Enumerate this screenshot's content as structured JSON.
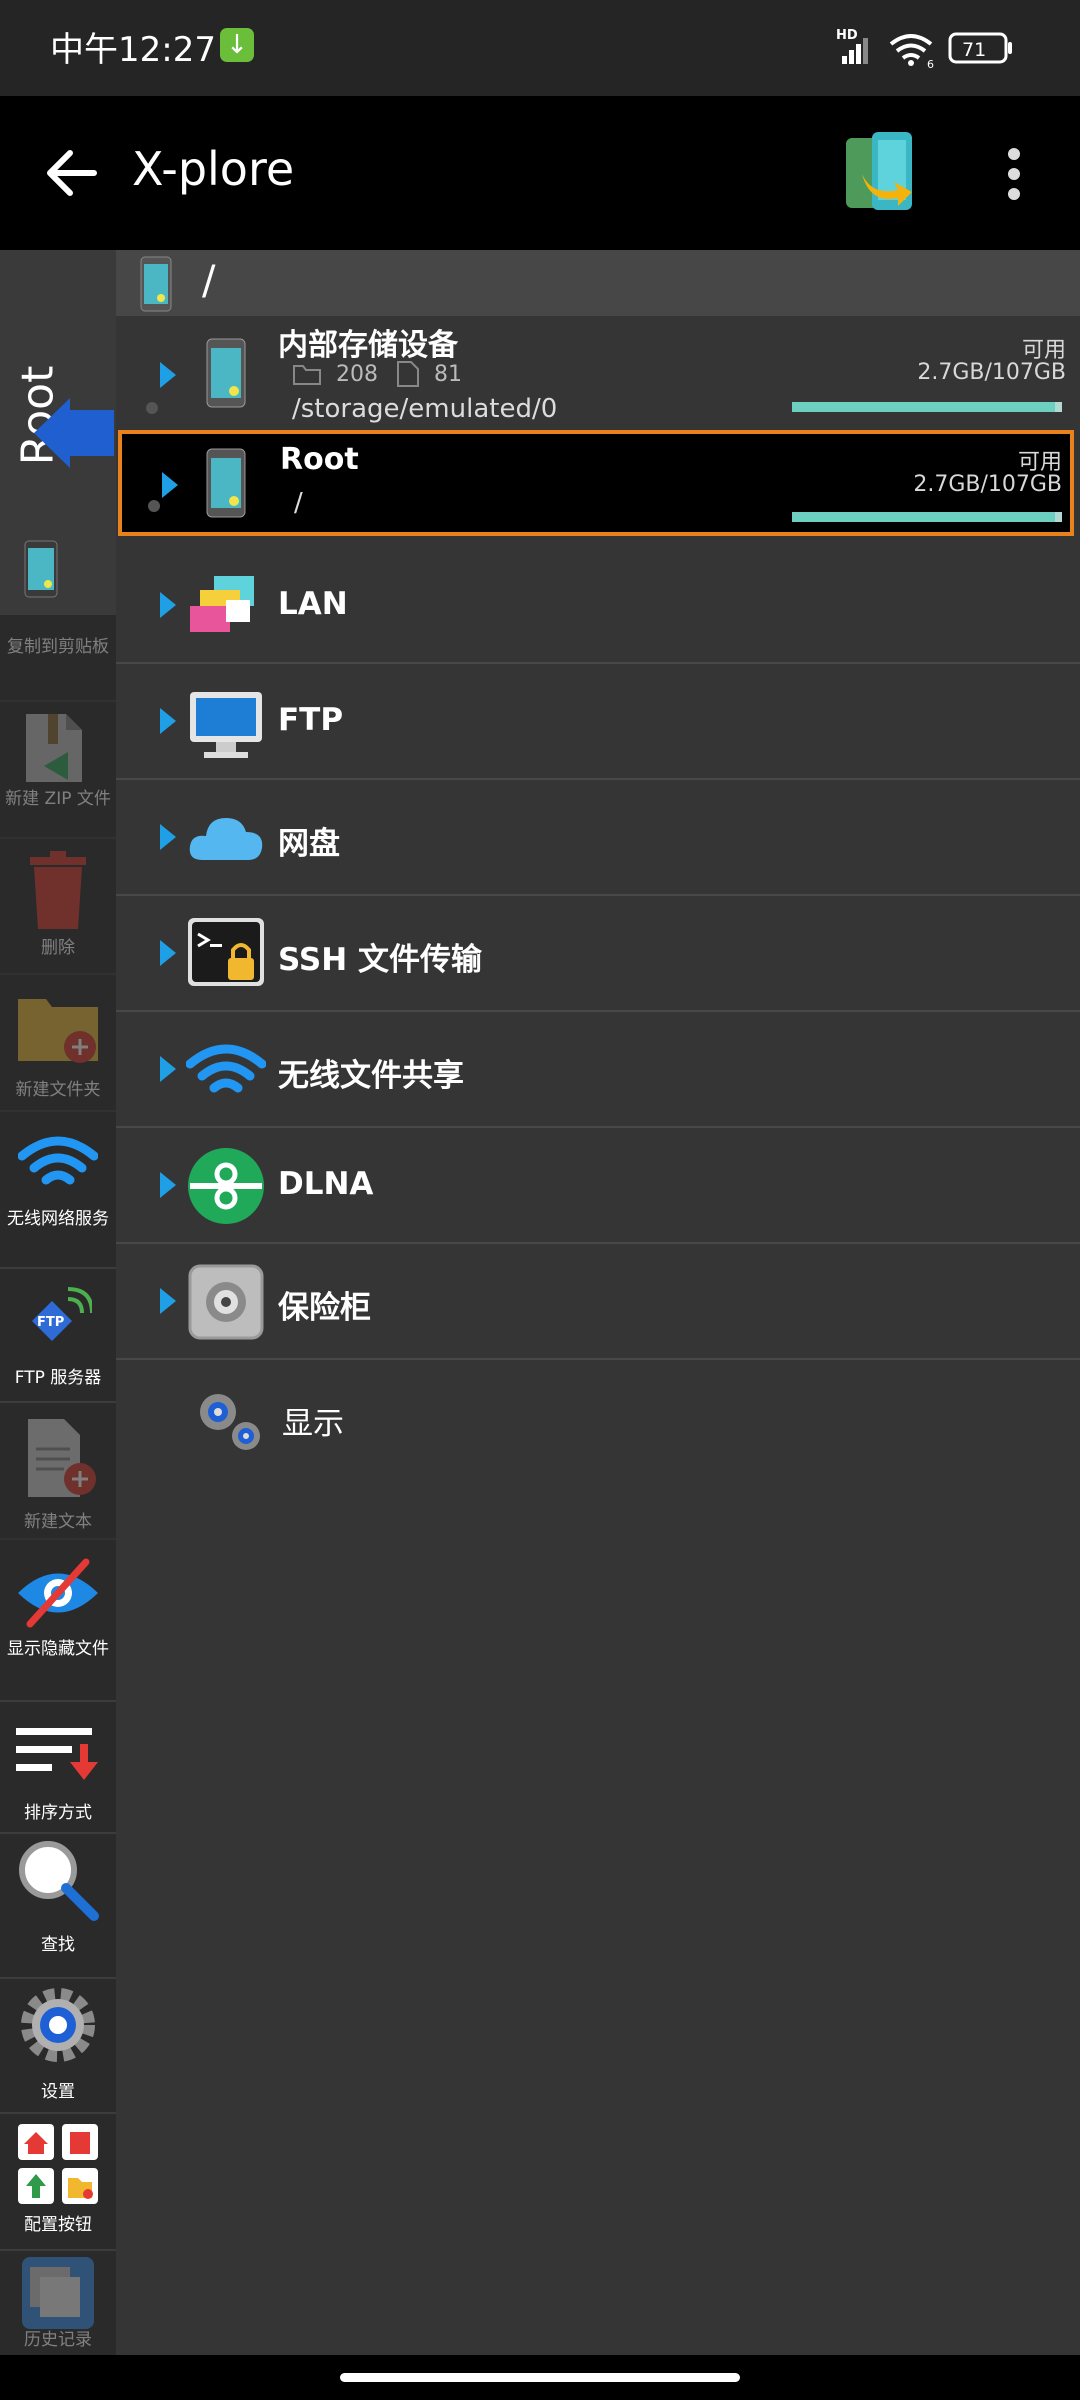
{
  "status_bar": {
    "time": "中午12:27",
    "network": "HD",
    "wifi_badge": "6",
    "battery": "71"
  },
  "app_bar": {
    "title": "X-plore"
  },
  "sidebar": {
    "root_tab": "Root",
    "items": [
      {
        "label": "复制到剪贴板",
        "icon": "clipboard-icon"
      },
      {
        "label": "新建 ZIP 文件",
        "icon": "zip-icon"
      },
      {
        "label": "删除",
        "icon": "trash-icon"
      },
      {
        "label": "新建文件夹",
        "icon": "new-folder-icon"
      },
      {
        "label": "无线网络服务",
        "icon": "wifi-icon"
      },
      {
        "label": "FTP 服务器",
        "icon": "ftp-server-icon"
      },
      {
        "label": "新建文本",
        "icon": "new-text-icon"
      },
      {
        "label": "显示隐藏文件",
        "icon": "hidden-files-icon"
      },
      {
        "label": "排序方式",
        "icon": "sort-icon"
      },
      {
        "label": "查找",
        "icon": "search-icon"
      },
      {
        "label": "设置",
        "icon": "gear-icon"
      },
      {
        "label": "配置按钮",
        "icon": "config-buttons-icon"
      },
      {
        "label": "历史记录",
        "icon": "history-icon"
      }
    ]
  },
  "breadcrumb": {
    "path": "/"
  },
  "volumes": [
    {
      "name": "内部存储设备",
      "folders": "208",
      "files": "81",
      "path": "/storage/emulated/0",
      "avail_label": "可用",
      "avail": "2.7GB/107GB",
      "used_fraction": 0.975
    },
    {
      "name": "Root",
      "path": "/",
      "avail_label": "可用",
      "avail": "2.7GB/107GB",
      "used_fraction": 0.975
    }
  ],
  "entries": [
    {
      "label": "LAN",
      "icon": "lan-icon"
    },
    {
      "label": "FTP",
      "icon": "ftp-icon"
    },
    {
      "label": "网盘",
      "icon": "cloud-icon"
    },
    {
      "label": "SSH 文件传输",
      "icon": "ssh-icon"
    },
    {
      "label": "无线文件共享",
      "icon": "wifi-share-icon"
    },
    {
      "label": "DLNA",
      "icon": "dlna-icon"
    },
    {
      "label": "保险柜",
      "icon": "vault-icon"
    }
  ],
  "display": {
    "label": "显示"
  },
  "colors": {
    "accent": "#1e9fe6",
    "selected_border": "#e8821d",
    "storage_bar": "#6ccfc0"
  }
}
